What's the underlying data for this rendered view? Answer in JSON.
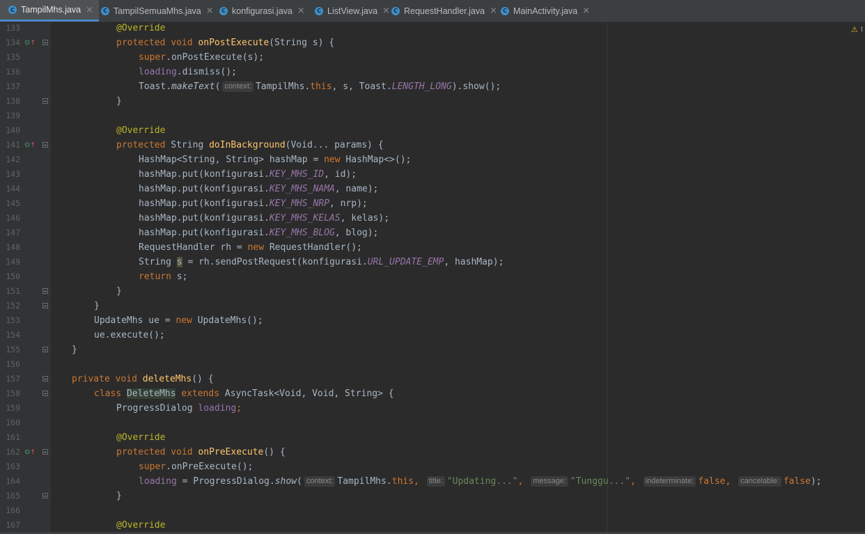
{
  "tabs": [
    {
      "label": "TampilMhs.java",
      "active": true,
      "icon": "java-class-icon"
    },
    {
      "label": "TampilSemuaMhs.java",
      "active": false,
      "icon": "java-class-icon"
    },
    {
      "label": "konfigurasi.java",
      "active": false,
      "icon": "java-class-icon"
    },
    {
      "label": "ListView.java",
      "active": false,
      "icon": "java-class-icon"
    },
    {
      "label": "RequestHandler.java",
      "active": false,
      "icon": "java-class-icon"
    },
    {
      "label": "MainActivity.java",
      "active": false,
      "icon": "java-class-icon"
    }
  ],
  "tab_close_glyph": "×",
  "class_icon_glyph": "C",
  "gutter": {
    "line_numbers": [
      "133",
      "134",
      "135",
      "136",
      "137",
      "138",
      "139",
      "140",
      "141",
      "142",
      "143",
      "144",
      "145",
      "146",
      "147",
      "148",
      "149",
      "150",
      "151",
      "152",
      "153",
      "154",
      "155",
      "156",
      "157",
      "158",
      "159",
      "160",
      "161",
      "162",
      "163",
      "164",
      "165",
      "166",
      "167"
    ],
    "override_lines": [
      "134",
      "141",
      "162"
    ],
    "fold_lines": [
      "134",
      "138",
      "141",
      "151",
      "152",
      "155",
      "157",
      "158",
      "162",
      "165"
    ]
  },
  "editor": {
    "warning_glyph": "⚠",
    "warning_partial": "t",
    "code_lines": [
      [
        {
          "t": "@Override",
          "c": "an"
        }
      ],
      [
        {
          "t": "protected ",
          "c": "kw"
        },
        {
          "t": "void ",
          "c": "kw"
        },
        {
          "t": "onPostExecute",
          "c": "fn"
        },
        {
          "t": "(String s) {"
        }
      ],
      [
        {
          "t": "super",
          "c": "kw"
        },
        {
          "t": ".onPostExecute(s);"
        }
      ],
      [
        {
          "t": "loading",
          "c": "fld"
        },
        {
          "t": ".dismiss();"
        }
      ],
      [
        {
          "t": "Toast."
        },
        {
          "t": "makeText",
          "c": "mi"
        },
        {
          "t": "("
        },
        {
          "h": "context:"
        },
        {
          "t": "TampilMhs."
        },
        {
          "t": "this",
          "c": "kw"
        },
        {
          "t": ", s, Toast."
        },
        {
          "t": "LENGTH_LONG",
          "c": "sf"
        },
        {
          "t": ").show();"
        }
      ],
      [
        {
          "t": "}"
        }
      ],
      [],
      [
        {
          "t": "@Override",
          "c": "an"
        }
      ],
      [
        {
          "t": "protected ",
          "c": "kw"
        },
        {
          "t": "String "
        },
        {
          "t": "doInBackground",
          "c": "fn"
        },
        {
          "t": "(Void... params) {"
        }
      ],
      [
        {
          "t": "HashMap<String, String> hashMap = "
        },
        {
          "t": "new ",
          "c": "kw"
        },
        {
          "t": "HashMap<>();"
        }
      ],
      [
        {
          "t": "hashMap.put(konfigurasi."
        },
        {
          "t": "KEY_MHS_ID",
          "c": "sf"
        },
        {
          "t": ", id);"
        }
      ],
      [
        {
          "t": "hashMap.put(konfigurasi."
        },
        {
          "t": "KEY_MHS_NAMA",
          "c": "sf"
        },
        {
          "t": ", name);"
        }
      ],
      [
        {
          "t": "hashMap.put(konfigurasi."
        },
        {
          "t": "KEY_MHS_NRP",
          "c": "sf"
        },
        {
          "t": ", nrp);"
        }
      ],
      [
        {
          "t": "hashMap.put(konfigurasi."
        },
        {
          "t": "KEY_MHS_KELAS",
          "c": "sf"
        },
        {
          "t": ", kelas);"
        }
      ],
      [
        {
          "t": "hashMap.put(konfigurasi."
        },
        {
          "t": "KEY_MHS_BLOG",
          "c": "sf"
        },
        {
          "t": ", blog);"
        }
      ],
      [
        {
          "t": "RequestHandler rh = "
        },
        {
          "t": "new ",
          "c": "kw"
        },
        {
          "t": "RequestHandler();"
        }
      ],
      [
        {
          "t": "String "
        },
        {
          "t": "s",
          "c": "hl"
        },
        {
          "t": " = rh.sendPostRequest(konfigurasi."
        },
        {
          "t": "URL_UPDATE_EMP",
          "c": "sf"
        },
        {
          "t": ", hashMap);"
        }
      ],
      [
        {
          "t": "return ",
          "c": "kw"
        },
        {
          "t": "s;"
        }
      ],
      [
        {
          "t": "}"
        }
      ],
      [
        {
          "t": "}"
        }
      ],
      [
        {
          "t": "UpdateMhs ue = "
        },
        {
          "t": "new ",
          "c": "kw"
        },
        {
          "t": "UpdateMhs();"
        }
      ],
      [
        {
          "t": "ue.execute();"
        }
      ],
      [
        {
          "t": "}"
        }
      ],
      [],
      [
        {
          "t": "private ",
          "c": "kw"
        },
        {
          "t": "void ",
          "c": "kw"
        },
        {
          "t": "deleteMhs",
          "c": "fn"
        },
        {
          "t": "() {"
        }
      ],
      [
        {
          "t": "class ",
          "c": "kw"
        },
        {
          "t": "DeleteMhs",
          "c": "hl2"
        },
        {
          "t": " "
        },
        {
          "t": "extends ",
          "c": "kw"
        },
        {
          "t": "AsyncTask<Void, Void, String> {"
        }
      ],
      [
        {
          "t": "ProgressDialog "
        },
        {
          "t": "loading",
          "c": "fld"
        },
        {
          "t": ";",
          "c": "kw"
        }
      ],
      [],
      [
        {
          "t": "@Override",
          "c": "an"
        }
      ],
      [
        {
          "t": "protected ",
          "c": "kw"
        },
        {
          "t": "void ",
          "c": "kw"
        },
        {
          "t": "onPreExecute",
          "c": "fn"
        },
        {
          "t": "() {"
        }
      ],
      [
        {
          "t": "super",
          "c": "kw"
        },
        {
          "t": ".onPreExecute();"
        }
      ],
      [
        {
          "t": "loading",
          "c": "fld"
        },
        {
          "t": " = ProgressDialog."
        },
        {
          "t": "show",
          "c": "mi"
        },
        {
          "t": "("
        },
        {
          "h": "context:"
        },
        {
          "t": "TampilMhs."
        },
        {
          "t": "this",
          "c": "kw"
        },
        {
          "t": ", ",
          "c": "kw"
        },
        {
          "h": "title:"
        },
        {
          "t": "\"Updating...\"",
          "c": "st"
        },
        {
          "t": ", ",
          "c": "kw"
        },
        {
          "h": "message:"
        },
        {
          "t": "\"Tunggu...\"",
          "c": "st"
        },
        {
          "t": ", ",
          "c": "kw"
        },
        {
          "h": "indeterminate:"
        },
        {
          "t": "false",
          "c": "kw"
        },
        {
          "t": ", ",
          "c": "kw"
        },
        {
          "h": "cancelable:"
        },
        {
          "t": "false",
          "c": "kw"
        },
        {
          "t": ");"
        }
      ],
      [
        {
          "t": "}"
        }
      ],
      [],
      [
        {
          "t": "@Override",
          "c": "an"
        }
      ]
    ]
  }
}
